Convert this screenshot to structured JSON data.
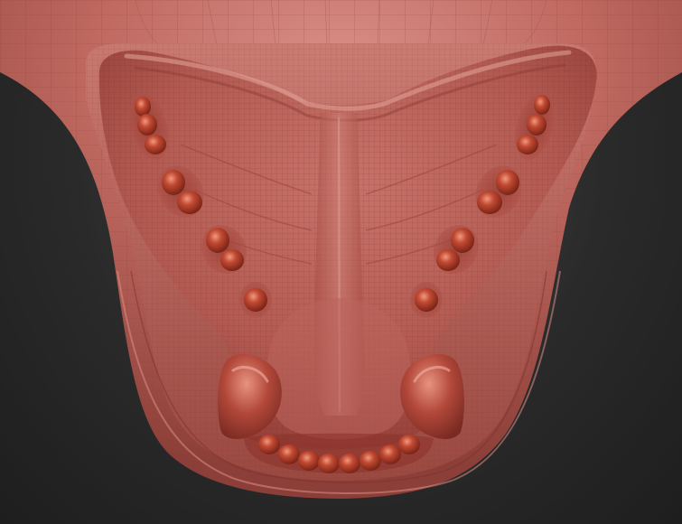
{
  "scene": {
    "subject": "sculpted-upper-palate-with-teeth",
    "background_color": "#2b2b2b",
    "material_color": "#b8534a",
    "wireframe_color": "#8a3a33",
    "tooth_color": "#b8412c"
  }
}
